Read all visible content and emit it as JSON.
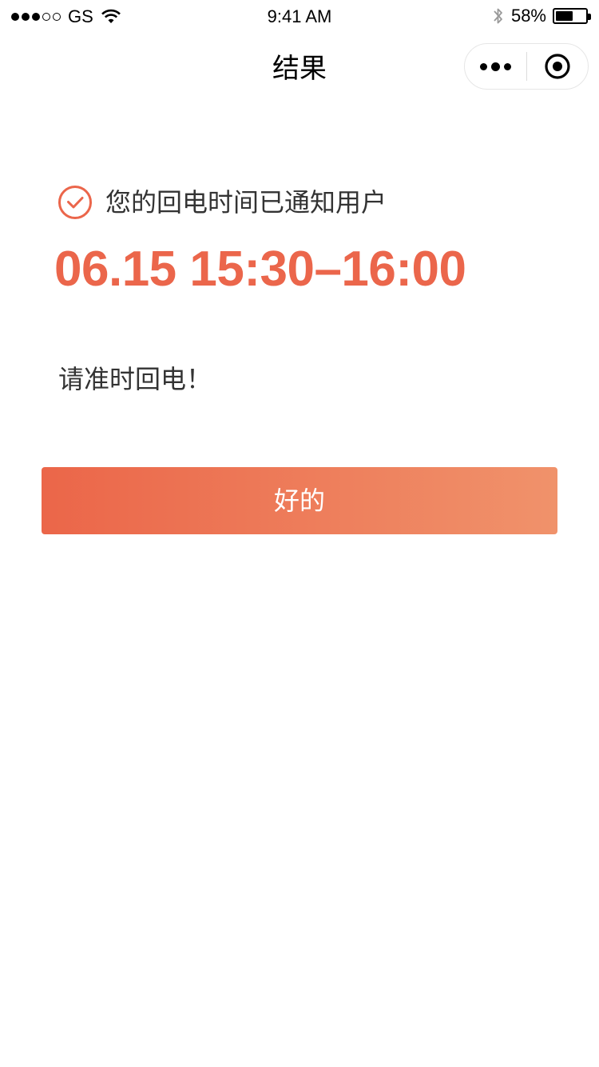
{
  "status_bar": {
    "carrier": "GS",
    "time": "9:41 AM",
    "battery_percent": "58%",
    "battery_level": 0.58,
    "signal_bars_filled": 3,
    "signal_bars_total": 5
  },
  "nav": {
    "title": "结果",
    "more_icon": "more-dots-icon",
    "close_icon": "target-close-icon"
  },
  "main": {
    "notice": "您的回电时间已通知用户",
    "time_range": "06.15 15:30–16:00",
    "reminder": "请准时回电！",
    "ok_button_label": "好的"
  },
  "colors": {
    "accent": "#eb664b",
    "button_gradient_start": "#eb6649",
    "button_gradient_end": "#f0926b"
  }
}
